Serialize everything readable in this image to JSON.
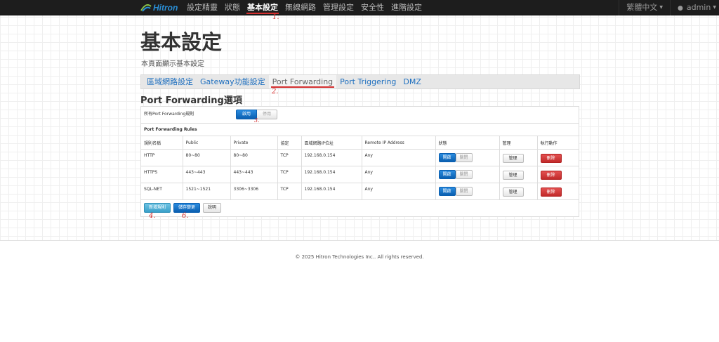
{
  "brand": {
    "name": "Hitron"
  },
  "nav": {
    "items": [
      "設定精靈",
      "狀態",
      "基本設定",
      "無線網路",
      "管理設定",
      "安全性",
      "進階設定"
    ],
    "active_index": 2
  },
  "lang": "繁體中文",
  "user": "admin",
  "page": {
    "title": "基本設定",
    "subtitle": "本頁面顯示基本設定"
  },
  "tabs": {
    "items": [
      "區域網路設定",
      "Gateway功能設定",
      "Port Forwarding",
      "Port Triggering",
      "DMZ"
    ],
    "active_index": 2
  },
  "section_title": "Port Forwarding選項",
  "toggle": {
    "label": "所有Port Forwarding規則",
    "enable": "啟用",
    "disable": "停用",
    "active": "enable"
  },
  "rules": {
    "title": "Port Forwarding Rules",
    "headers": [
      "規則名稱",
      "Public",
      "Private",
      "協定",
      "區域網路IP位址",
      "Remote IP Address",
      "狀態",
      "管理",
      "執行動作"
    ],
    "rows": [
      {
        "name": "HTTP",
        "public": "80~80",
        "private": "80~80",
        "protocol": "TCP",
        "lan_ip": "192.168.0.154",
        "remote_ip": "Any"
      },
      {
        "name": "HTTPS",
        "public": "443~443",
        "private": "443~443",
        "protocol": "TCP",
        "lan_ip": "192.168.0.154",
        "remote_ip": "Any"
      },
      {
        "name": "SQL-NET",
        "public": "1521~1521",
        "private": "3306~3306",
        "protocol": "TCP",
        "lan_ip": "192.168.0.154",
        "remote_ip": "Any"
      }
    ],
    "status_on": "開啟",
    "status_off": "關閉",
    "manage": "管理",
    "delete": "刪除"
  },
  "actions": {
    "add": "新增規則",
    "save": "儲存變更",
    "help": "說明"
  },
  "annotations": [
    "1.",
    "2.",
    "3.",
    "4.",
    "6."
  ],
  "footer": "© 2025 Hitron Technologies Inc.. All rights reserved.",
  "colors": {
    "accent_blue": "#0a6cc7",
    "danger": "#d9534f",
    "annotation": "#d32f2f",
    "navbar": "#1d1d1d"
  }
}
